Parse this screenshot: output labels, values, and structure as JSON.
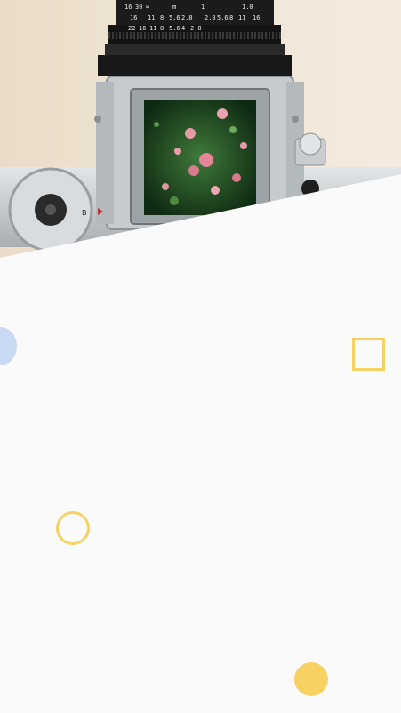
{
  "colors": {
    "background": "#fafafa",
    "wall": "#efe3d2",
    "accent_yellow": "#f7d262",
    "accent_blue": "#c9d8f3",
    "camera_metal": "#cfd3d6",
    "camera_dark": "#1a1a1a"
  },
  "hero": {
    "icon": "camera-photo",
    "lens_scale_top": [
      "16",
      "30",
      "∞",
      "m",
      "1",
      "1.0"
    ],
    "lens_scale_mid": [
      "16",
      "11",
      "8",
      "5.6",
      "2.8",
      "2.8",
      "5.6",
      "8",
      "11",
      "16"
    ],
    "lens_scale_bottom": [
      "22",
      "16",
      "11",
      "8",
      "5.6",
      "4",
      "2.8"
    ],
    "dial_label": "B"
  },
  "decorations": [
    "blue-circle",
    "outline-square",
    "outline-circle",
    "filled-circle"
  ]
}
